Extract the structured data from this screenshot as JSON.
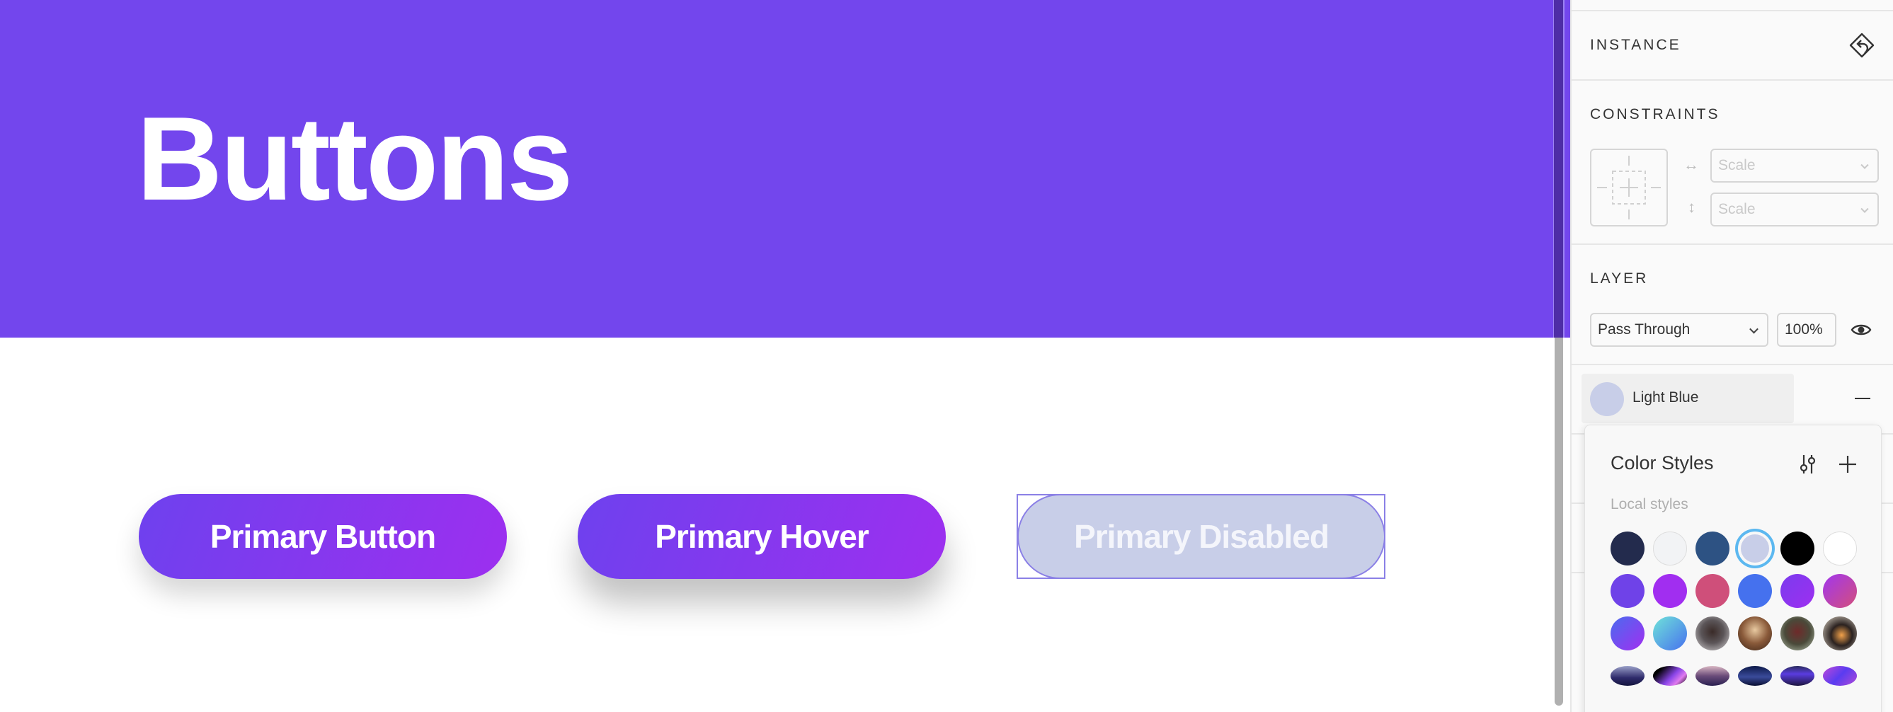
{
  "canvas": {
    "hero": {
      "title": "Buttons",
      "background": "#7346ED"
    },
    "buttons": [
      {
        "label": "Primary Button",
        "state": "default"
      },
      {
        "label": "Primary Hover",
        "state": "hover"
      },
      {
        "label": "Primary Disabled",
        "state": "disabled",
        "selected": true
      }
    ]
  },
  "panel": {
    "instance": {
      "title": "INSTANCE",
      "icon": "go-to-master-icon"
    },
    "constraints": {
      "title": "CONSTRAINTS",
      "horizontal": {
        "value": "Scale",
        "icon": "horizontal-arrows-icon"
      },
      "vertical": {
        "value": "Scale",
        "icon": "vertical-arrows-icon"
      }
    },
    "layer": {
      "title": "LAYER",
      "blend_mode": "Pass Through",
      "opacity": "100%",
      "visibility_icon": "eye-icon"
    },
    "fill_style": {
      "name": "Light Blue",
      "color": "#C8CEE8",
      "remove_icon": "minus-icon"
    }
  },
  "color_styles_popup": {
    "title": "Color Styles",
    "subtitle": "Local styles",
    "icons": [
      "sliders-icon",
      "plus-icon"
    ],
    "selected_ring_color": "#5CB8F0",
    "rows": [
      [
        {
          "fill": "#232B4D"
        },
        {
          "fill": "#F2F3F5",
          "bordered": true
        },
        {
          "fill": "#2D5283"
        },
        {
          "fill": "#C8CEE8",
          "selected": true
        },
        {
          "fill": "#000000"
        },
        {
          "fill": "#FFFFFF",
          "bordered": true
        }
      ],
      [
        {
          "fill": "#6F42E8"
        },
        {
          "fill": "#A12EF0"
        },
        {
          "fill": "#CF4F7A"
        },
        {
          "fill": "#4571EE"
        },
        {
          "fill": "linear-gradient(135deg,#7B3BEE,#9D2FF0)"
        },
        {
          "fill": "linear-gradient(135deg,#A136EE,#D34F7C)"
        }
      ],
      [
        {
          "fill": "linear-gradient(135deg,#4A6CEF,#A12EF0)"
        },
        {
          "fill": "linear-gradient(135deg,#6FE3D9,#4771EE)"
        },
        {
          "fill": "radial-gradient(circle at 50% 45%,#3A2B28 0%,#5B5558 45%,#D9D6D8 100%)",
          "kind": "photo"
        },
        {
          "fill": "radial-gradient(circle at 50% 40%,#E8C9A0 0%,#8A5A3A 50%,#3B2418 100%)",
          "kind": "photo"
        },
        {
          "fill": "radial-gradient(circle at 50% 45%,#6E2A2A 0%,#4A4A3A 50%,#B9C7B2 100%)",
          "kind": "photo"
        },
        {
          "fill": "radial-gradient(circle at 55% 55%,#F2A14A 0%,#2B2220 40%,#E9E1D2 100%)",
          "kind": "photo"
        }
      ],
      [
        {
          "fill": "linear-gradient(180deg,#9AA0C8 0%,#2E2A6B 60%,#15163E 100%)",
          "kind": "photo"
        },
        {
          "fill": "linear-gradient(135deg,#000000 20%,#8A45E8 55%,#E17BEF 75%,#000000 100%)",
          "kind": "photo"
        },
        {
          "fill": "linear-gradient(180deg,#D9B7C3 0%,#6B4C7A 50%,#2A2050 100%)",
          "kind": "photo"
        },
        {
          "fill": "linear-gradient(180deg,#0E1A4A 0%,#3A4B9A 55%,#0B1033 100%)",
          "kind": "photo"
        },
        {
          "fill": "linear-gradient(180deg,#2B2C5E 0%,#5A3CE0 40%,#1E1740 100%)",
          "kind": "photo"
        },
        {
          "fill": "linear-gradient(135deg,#C04AD8 0%,#5A3CF0 50%,#B04AD8 100%)",
          "kind": "photo"
        }
      ]
    ]
  }
}
